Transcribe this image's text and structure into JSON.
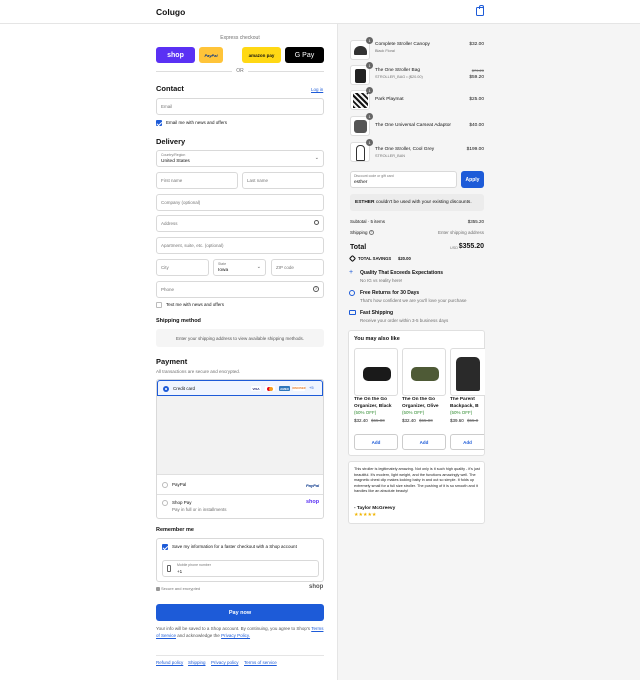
{
  "header": {
    "brand": "Colugo",
    "cart_icon": "shopping-bag-icon"
  },
  "express": {
    "title": "Express checkout",
    "or": "OR",
    "buttons": [
      {
        "label": "shop",
        "bg": "#5a31f4",
        "fg": "#ffffff"
      },
      {
        "label": "PayPal",
        "bg": "#ffc439",
        "fg": "#003087"
      },
      {
        "label": "amazon pay",
        "bg": "#ffd814",
        "fg": "#111111"
      },
      {
        "label": "G Pay",
        "bg": "#000000",
        "fg": "#ffffff"
      }
    ]
  },
  "contact": {
    "title": "Contact",
    "login": "Log in",
    "email_placeholder": "Email",
    "news_label": "Email me with news and offers",
    "news_checked": true
  },
  "delivery": {
    "title": "Delivery",
    "country_label": "Country/Region",
    "country_value": "United States",
    "first_name": "First name",
    "last_name": "Last name",
    "company": "Company (optional)",
    "address": "Address",
    "apartment": "Apartment, suite, etc. (optional)",
    "city": "City",
    "state_label": "State",
    "state_value": "Iowa",
    "zip": "ZIP code",
    "phone": "Phone",
    "sms_label": "Text me with news and offers",
    "sms_checked": false
  },
  "shipping_method": {
    "title": "Shipping method",
    "message": "Enter your shipping address to view available shipping methods."
  },
  "payment": {
    "title": "Payment",
    "subtitle": "All transactions are secure and encrypted.",
    "credit_card": "Credit card",
    "card_logos": [
      "VISA",
      "MC",
      "AMEX",
      "DISCOVER",
      "+5"
    ],
    "paypal": "PayPal",
    "paypal_logo": "PayPal",
    "shoppay": "Shop Pay",
    "shoppay_sub": "Pay in full or in installments",
    "shoppay_logo": "shop"
  },
  "remember": {
    "title": "Remember me",
    "save_label": "Save my information for a faster checkout with a Shop account",
    "save_checked": true,
    "phone_label": "Mobile phone number",
    "phone_value": "+1",
    "secure": "Secure and encrypted",
    "shop_logo": "shop"
  },
  "pay_now": "Pay now",
  "legal": {
    "text1": "Your info will be saved to a Shop account. By continuing, you agree to Shop's",
    "tos": "Terms of Service",
    "text2": "and acknowledge the",
    "privacy": "Privacy Policy."
  },
  "footer_links": [
    "Refund policy",
    "Shipping",
    "Privacy policy",
    "Terms of service"
  ],
  "summary": {
    "items": [
      {
        "qty": "1",
        "name": "Complete Stroller Canopy",
        "sub": "Black Floral",
        "price": "$32.00",
        "old_price": ""
      },
      {
        "qty": "1",
        "name": "The One Stroller Bag",
        "sub": "STROLLER_BAG • ($20.00)",
        "price": "$59.20",
        "old_price": "$79.20"
      },
      {
        "qty": "1",
        "name": "Park Playmat",
        "sub": "",
        "price": "$25.00",
        "old_price": ""
      },
      {
        "qty": "1",
        "name": "The One Universal Carseat Adaptor",
        "sub": "",
        "price": "$40.00",
        "old_price": ""
      },
      {
        "qty": "1",
        "name": "The One Stroller, Cool Grey",
        "sub": "STROLLER_BAN",
        "price": "$199.00",
        "old_price": ""
      }
    ],
    "discount_label": "Discount code or gift card",
    "discount_value": "esther",
    "apply": "Apply",
    "discount_error_code": "ESTHER",
    "discount_error": "couldn't be used with your existing discounts.",
    "subtotal_label": "Subtotal · 5 items",
    "subtotal": "$355.20",
    "shipping_label": "Shipping",
    "shipping_value": "Enter shipping address",
    "total_label": "Total",
    "currency": "USD",
    "total": "$355.20",
    "savings_label": "TOTAL SAVINGS",
    "savings": "$20.00"
  },
  "features": [
    {
      "icon": "plus-icon",
      "title": "Quality That Exceeds Expectations",
      "sub": "No IG vs reality here!"
    },
    {
      "icon": "return-icon",
      "title": "Free Returns for 30 Days",
      "sub": "That's how confident we are you'll love your purchase"
    },
    {
      "icon": "truck-icon",
      "title": "Fast Shipping",
      "sub": "Receive your order within 3-5 business days"
    }
  ],
  "upsell": {
    "title": "You may also like",
    "add": "Add",
    "products": [
      {
        "name1": "The On the Go",
        "name2": "Organizer, Black",
        "off": "(50% OFF)",
        "price": "$32.40",
        "old": "$65.00",
        "color": "#1a1a1a"
      },
      {
        "name1": "The On the Go",
        "name2": "Organizer, Olive",
        "off": "(50% OFF)",
        "price": "$32.40",
        "old": "$65.00",
        "color": "#4e5a36"
      },
      {
        "name1": "The Parent",
        "name2": "Backpack, B",
        "off": "(50% OFF)",
        "price": "$39.60",
        "old": "$55.0",
        "color": "#2a2a2a"
      }
    ]
  },
  "review": {
    "text": "This stroller is legitimately amazing. Not only is it such high quality - it's just beautiful. It's modern, light weight, and the functions amazingly well. The magnetic chest clip makes locking baby in and out so simple. It folds up extremely small for a full size stroller. The pushing of it is so smooth and it handles like an absolute beauty!",
    "author": "- Taylor McGreevy",
    "stars": "★★★★★"
  },
  "colors": {
    "accent": "#1d5bd8",
    "star": "#f0b400"
  }
}
